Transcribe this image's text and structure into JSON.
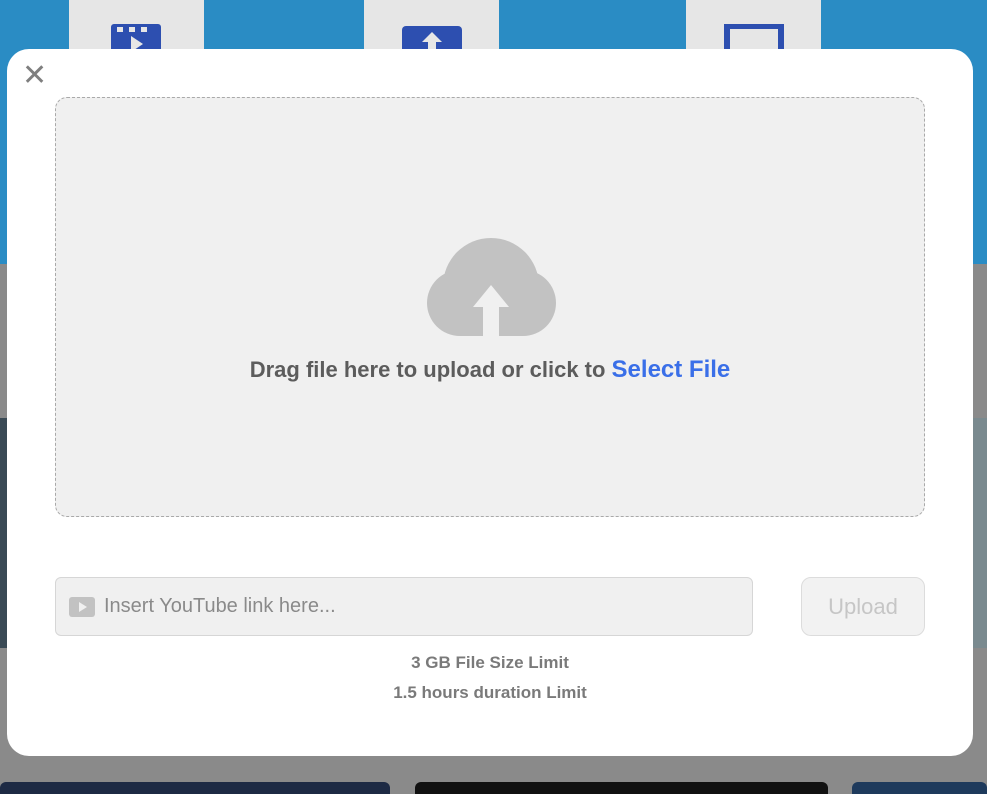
{
  "modal": {
    "close_glyph": "✕",
    "dropzone": {
      "prompt": "Drag file here to upload or click to ",
      "select_link": "Select File",
      "icon": "cloud-upload-icon"
    },
    "youtube": {
      "placeholder": "Insert YouTube link here...",
      "icon": "youtube-play-icon",
      "value": ""
    },
    "upload_label": "Upload",
    "limits": {
      "size": "3 GB File Size Limit",
      "duration": "1.5 hours duration Limit"
    }
  },
  "colors": {
    "accent_link": "#3a6fe8",
    "background_hero": "#2a8cc4",
    "icon_gray": "#c2c2c2"
  }
}
